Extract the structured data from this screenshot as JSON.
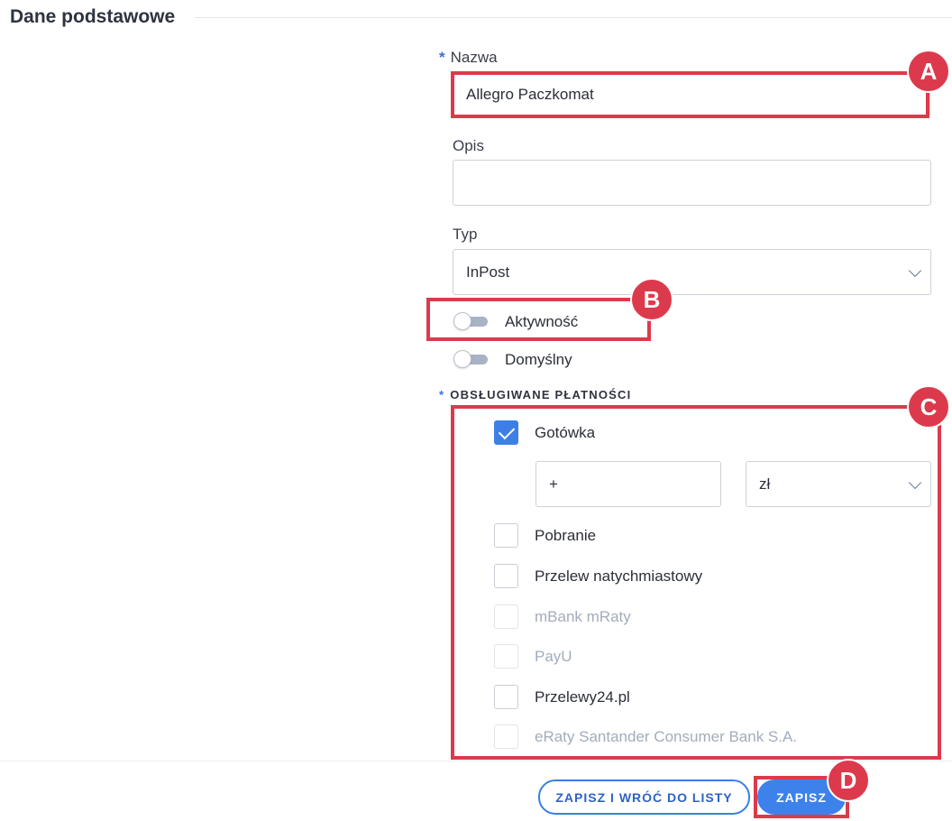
{
  "section": {
    "title": "Dane podstawowe"
  },
  "form": {
    "name": {
      "required_mark": "*",
      "label": "Nazwa",
      "value": "Allegro Paczkomat"
    },
    "description": {
      "label": "Opis",
      "value": ""
    },
    "type": {
      "label": "Typ",
      "value": "InPost"
    },
    "active": {
      "label": "Aktywność",
      "on": false
    },
    "default": {
      "label": "Domyślny",
      "on": false
    }
  },
  "payments": {
    "required_mark": "*",
    "heading": "OBSŁUGIWANE PŁATNOŚCI",
    "items": [
      {
        "label": "Gotówka",
        "checked": true,
        "disabled": false
      },
      {
        "label": "Pobranie",
        "checked": false,
        "disabled": false
      },
      {
        "label": "Przelew natychmiastowy",
        "checked": false,
        "disabled": false
      },
      {
        "label": "mBank mRaty",
        "checked": false,
        "disabled": true
      },
      {
        "label": "PayU",
        "checked": false,
        "disabled": true
      },
      {
        "label": "Przelewy24.pl",
        "checked": false,
        "disabled": false
      },
      {
        "label": "eRaty Santander Consumer Bank S.A.",
        "checked": false,
        "disabled": true
      }
    ],
    "cash_surcharge": {
      "value": "+",
      "currency": "zł"
    }
  },
  "footer": {
    "save_and_back_label": "ZAPISZ I WRÓĆ DO LISTY",
    "save_label": "ZAPISZ"
  },
  "annotations": {
    "a": "A",
    "b": "B",
    "c": "C",
    "d": "D"
  },
  "colors": {
    "accent": "#3d82ea",
    "annotation": "#dc3a4c",
    "disabled_text": "#a3acbc"
  }
}
